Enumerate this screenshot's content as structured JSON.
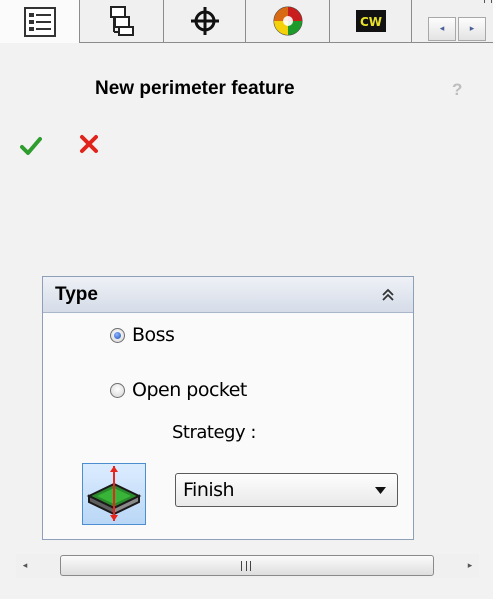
{
  "tabs": [
    {
      "name": "FeatureManager design tree",
      "icon": "feature-tree-icon",
      "active": true
    },
    {
      "name": "PropertyManager",
      "icon": "property-manager-icon",
      "active": false
    },
    {
      "name": "ConfigurationManager",
      "icon": "crosshair-icon",
      "active": false
    },
    {
      "name": "DisplayManager",
      "icon": "appearance-ball-icon",
      "active": false
    },
    {
      "name": "CAMWorks",
      "icon": "camworks-icon",
      "label": "CW",
      "active": false
    }
  ],
  "tab_scroll": {
    "left_glyph": "◂",
    "right_glyph": "▸"
  },
  "panel": {
    "title": "New perimeter feature",
    "help_glyph": "?"
  },
  "type_group": {
    "title": "Type",
    "options": [
      {
        "label": "Boss",
        "checked": true
      },
      {
        "label": "Open pocket",
        "checked": false
      }
    ],
    "strategy_label": "Strategy :",
    "strategy_value": "Finish"
  },
  "scrollbar": {
    "left_glyph": "◂",
    "right_glyph": "▸"
  },
  "colors": {
    "ok_green": "#2e9d2e",
    "cancel_red": "#e0241b",
    "group_header": "#d5dce8",
    "radio_blue": "#1a4fb8"
  }
}
